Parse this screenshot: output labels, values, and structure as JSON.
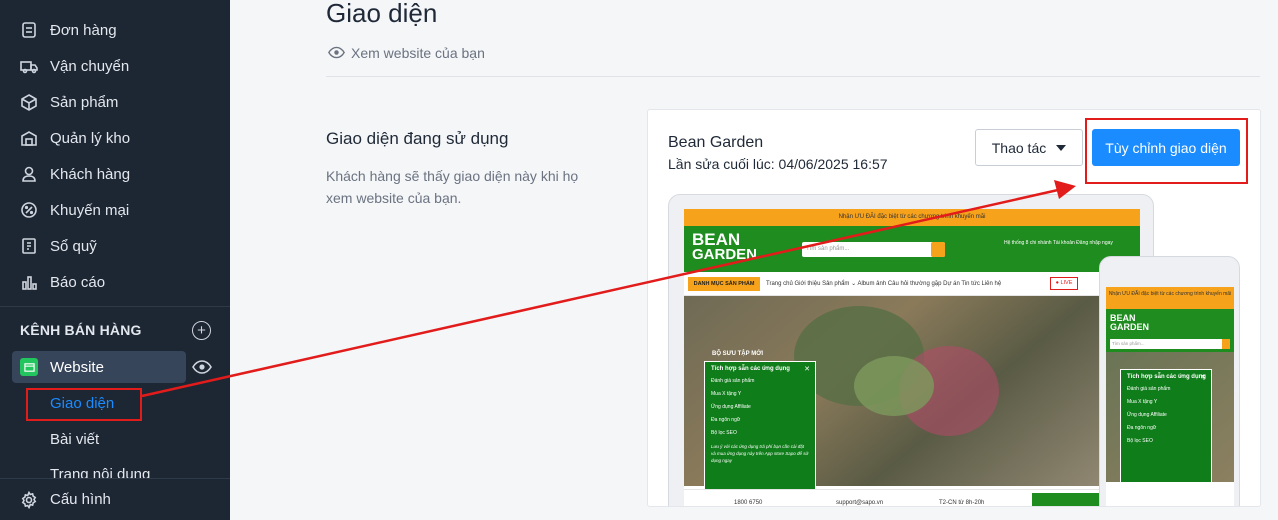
{
  "sidebar": {
    "items": [
      {
        "label": "Đơn hàng",
        "icon": "orders-icon"
      },
      {
        "label": "Vận chuyển",
        "icon": "truck-icon"
      },
      {
        "label": "Sản phẩm",
        "icon": "box-icon"
      },
      {
        "label": "Quản lý kho",
        "icon": "warehouse-icon"
      },
      {
        "label": "Khách hàng",
        "icon": "user-icon"
      },
      {
        "label": "Khuyến mại",
        "icon": "discount-icon"
      },
      {
        "label": "Sổ quỹ",
        "icon": "cashbook-icon"
      },
      {
        "label": "Báo cáo",
        "icon": "chart-icon"
      }
    ],
    "channel_title": "KÊNH BÁN HÀNG",
    "website_label": "Website",
    "sub_items": [
      "Giao diện",
      "Bài viết",
      "Trang nội dung"
    ],
    "config_label": "Cấu hình"
  },
  "main": {
    "title": "Giao diện",
    "view_site": "Xem website của bạn",
    "section_title": "Giao diện đang sử dụng",
    "section_desc": "Khách hàng sẽ thấy giao diện này khi họ xem website của bạn."
  },
  "theme": {
    "name": "Bean Garden",
    "last_edit": "Lần sửa cuối lúc: 04/06/2025 16:57",
    "actions_label": "Thao tác",
    "customize_label": "Tùy chỉnh giao diện"
  },
  "preview": {
    "promo": "Nhận ƯU ĐÃI đặc biệt từ các chương trình khuyến mãi",
    "brand_top": "BEAN",
    "brand_bottom": "GARDEN",
    "search_placeholder": "Tìm sản phẩm...",
    "header_links": "Hệ thống 8 chi nhánh   Tài khoản Đăng nhập ngay",
    "category_label": "DANH MỤC SẢN PHẨM",
    "nav_links": "Trang chủ   Giới thiệu   Sản phẩm ⌄   Album ảnh   Câu hỏi thường gặp   Dự án   Tin tức   Liên hệ",
    "live_label": "● LIVE",
    "hero_tag": "BỘ SƯU TẬP MỚI",
    "popup_title": "Tích hợp sẵn các ứng dụng",
    "popup_items": [
      "Đánh giá sản phẩm",
      "Mua X tặng Y",
      "Ứng dụng Affiliate",
      "Đa ngôn ngữ",
      "Bộ lọc SEO"
    ],
    "popup_note": "Lưu ý với các ứng dụng trả phí bạn cần cài đặt và mua ứng dụng này trên App store Sapo để sử dụng ngay",
    "footer_phone": "1800 6750",
    "footer_email": "support@sapo.vn",
    "footer_hours": "T2-CN từ 8h-20h"
  },
  "colors": {
    "sidebar_bg": "#1d2633",
    "accent": "#1a8cff",
    "highlight_red": "#e21b1b",
    "brand_green": "#1f8c1f",
    "brand_orange": "#f7a21b"
  }
}
